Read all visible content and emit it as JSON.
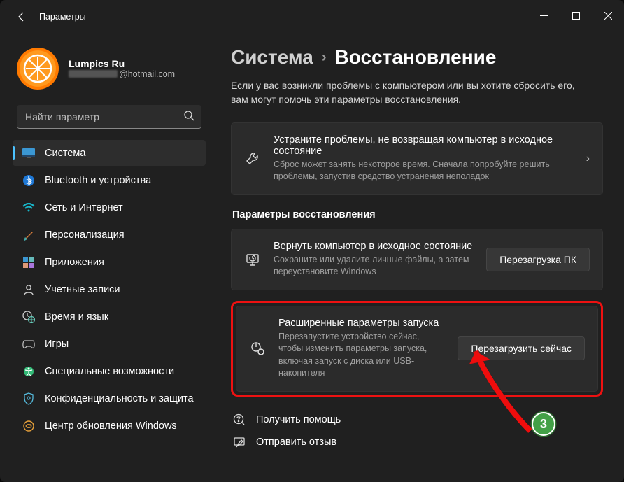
{
  "window": {
    "title": "Параметры"
  },
  "profile": {
    "name": "Lumpics Ru",
    "email_suffix": "@hotmail.com"
  },
  "search": {
    "placeholder": "Найти параметр"
  },
  "sidebar": {
    "items": [
      {
        "label": "Система"
      },
      {
        "label": "Bluetooth и устройства"
      },
      {
        "label": "Сеть и Интернет"
      },
      {
        "label": "Персонализация"
      },
      {
        "label": "Приложения"
      },
      {
        "label": "Учетные записи"
      },
      {
        "label": "Время и язык"
      },
      {
        "label": "Игры"
      },
      {
        "label": "Специальные возможности"
      },
      {
        "label": "Конфиденциальность и защита"
      },
      {
        "label": "Центр обновления Windows"
      }
    ]
  },
  "breadcrumb": {
    "parent": "Система",
    "current": "Восстановление"
  },
  "intro": "Если у вас возникли проблемы с компьютером или вы хотите сбросить его, вам могут помочь эти параметры восстановления.",
  "troubleshoot": {
    "title": "Устраните проблемы, не возвращая компьютер в исходное состояние",
    "desc": "Сброс может занять некоторое время. Сначала попробуйте решить проблемы, запустив средство устранения неполадок"
  },
  "section_title": "Параметры восстановления",
  "reset": {
    "title": "Вернуть компьютер в исходное состояние",
    "desc": "Сохраните или удалите личные файлы, а затем переустановите Windows",
    "button": "Перезагрузка ПК"
  },
  "advanced": {
    "title": "Расширенные параметры запуска",
    "desc": "Перезапустите устройство сейчас, чтобы изменить параметры запуска, включая запуск с диска или USB-накопителя",
    "button": "Перезагрузить сейчас"
  },
  "footer": {
    "help": "Получить помощь",
    "feedback": "Отправить отзыв"
  },
  "annotation": {
    "badge": "3"
  }
}
